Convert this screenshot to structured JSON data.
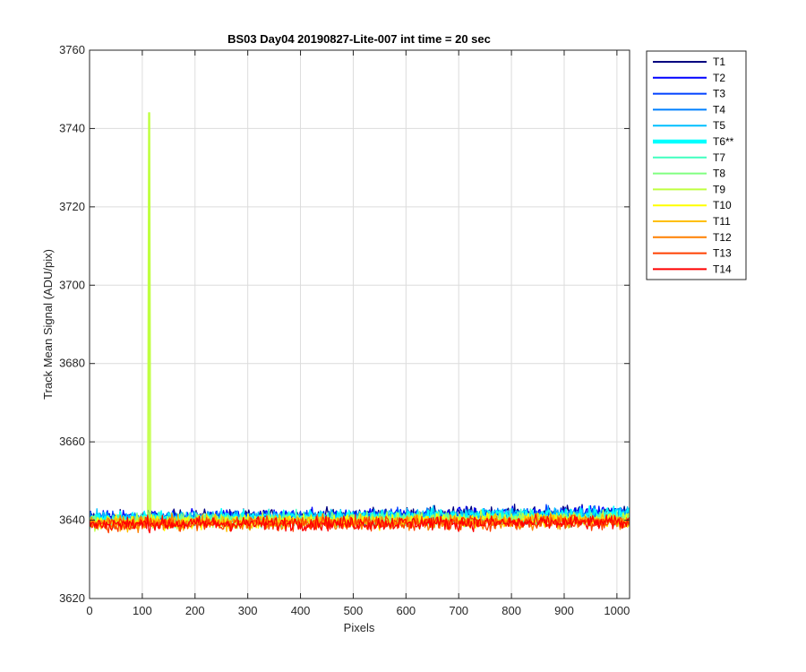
{
  "chart_data": {
    "type": "line",
    "title": "BS03 Day04 20190827-Lite-007 int time = 20 sec",
    "xlabel": "Pixels",
    "ylabel": "Track Mean Signal (ADU/pix)",
    "xlim": [
      0,
      1024
    ],
    "ylim": [
      3620,
      3760
    ],
    "xticks": [
      0,
      100,
      200,
      300,
      400,
      500,
      600,
      700,
      800,
      900,
      1000
    ],
    "yticks": [
      3620,
      3640,
      3660,
      3680,
      3700,
      3720,
      3740,
      3760
    ],
    "grid": true,
    "legend_position": "outside-top-right",
    "series": [
      {
        "name": "T1",
        "color": "#00007f",
        "mean": 3640.6,
        "slope": 1.5,
        "noise": 0.9
      },
      {
        "name": "T2",
        "color": "#0000ff",
        "mean": 3640.5,
        "slope": 1.4,
        "noise": 0.9
      },
      {
        "name": "T3",
        "color": "#0040ff",
        "mean": 3640.3,
        "slope": 1.3,
        "noise": 0.9
      },
      {
        "name": "T4",
        "color": "#0080ff",
        "mean": 3640.2,
        "slope": 1.2,
        "noise": 0.9
      },
      {
        "name": "T5",
        "color": "#00bfff",
        "mean": 3640.4,
        "slope": 1.4,
        "noise": 0.9
      },
      {
        "name": "T6**",
        "color": "#00ffff",
        "mean": 3640.3,
        "slope": 1.2,
        "noise": 0.9,
        "emphasized": true
      },
      {
        "name": "T7",
        "color": "#40ffbf",
        "mean": 3639.8,
        "slope": 0.9,
        "noise": 0.9
      },
      {
        "name": "T8",
        "color": "#80ff80",
        "mean": 3639.7,
        "slope": 0.8,
        "noise": 0.9
      },
      {
        "name": "T9",
        "color": "#bfff40",
        "mean": 3639.6,
        "slope": 0.8,
        "noise": 0.9,
        "spike": {
          "x": 113,
          "y": 3744
        }
      },
      {
        "name": "T10",
        "color": "#ffff00",
        "mean": 3639.4,
        "slope": 0.6,
        "noise": 0.9
      },
      {
        "name": "T11",
        "color": "#ffbf00",
        "mean": 3639.3,
        "slope": 0.6,
        "noise": 0.9
      },
      {
        "name": "T12",
        "color": "#ff8000",
        "mean": 3639.1,
        "slope": 0.5,
        "noise": 0.9
      },
      {
        "name": "T13",
        "color": "#ff4000",
        "mean": 3639.0,
        "slope": 0.5,
        "noise": 0.9
      },
      {
        "name": "T14",
        "color": "#ff0000",
        "mean": 3639.0,
        "slope": 0.4,
        "noise": 0.9
      }
    ]
  }
}
